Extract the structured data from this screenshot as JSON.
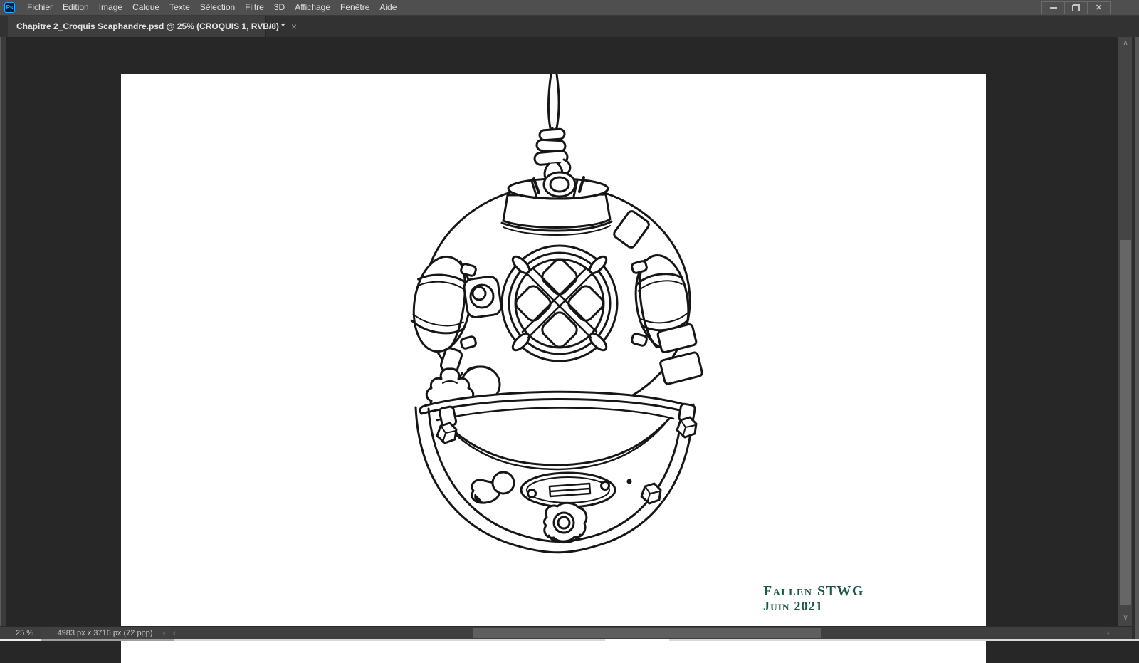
{
  "app_bar": {
    "logo_text": "Ps",
    "logo_colors": {
      "border": "#31a8ff",
      "background": "#001d33"
    },
    "menus": [
      "Fichier",
      "Edition",
      "Image",
      "Calque",
      "Texte",
      "Sélection",
      "Filtre",
      "3D",
      "Affichage",
      "Fenêtre",
      "Aide"
    ],
    "window_controls": {
      "minimize_icon": "minimize-bar",
      "restore_icon": "restore-squares",
      "close_glyph": "✕"
    }
  },
  "tab_bar": {
    "active_tab": {
      "title": "Chapitre 2_Croquis Scaphandre.psd @ 25% (CROQUIS 1, RVB/8) *",
      "close_glyph": "×"
    }
  },
  "document": {
    "signature_line1": "Fallen STWG",
    "signature_line2": "Juin 2021",
    "signature_color": "#1c584a"
  },
  "status_bar": {
    "zoom_value": "25 %",
    "document_dimensions": "4983 px x 3716 px (72 ppp)",
    "flyout_glyph": "›"
  },
  "scrollbars": {
    "up_glyph": "∧",
    "down_glyph": "∨",
    "left_glyph": "‹",
    "right_glyph": "›"
  }
}
